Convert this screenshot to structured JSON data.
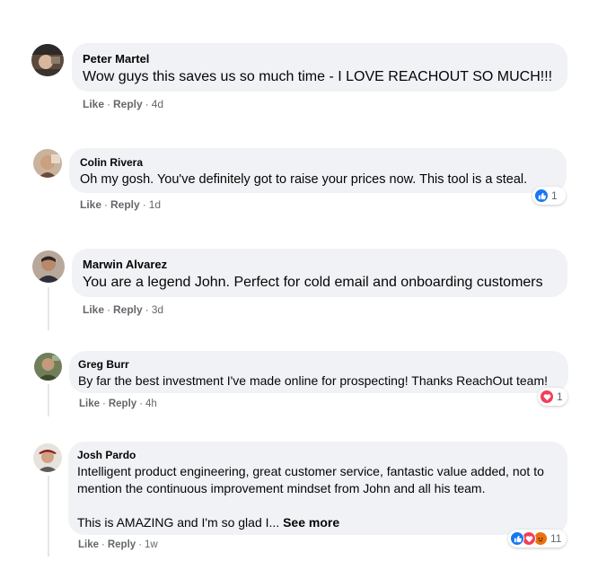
{
  "colors": {
    "bubble_bg": "#f0f2f5",
    "meta_text": "#65676b",
    "like_blue": "#1877f2",
    "love_red": "#f33e58",
    "angry_orange": "#e9710f"
  },
  "comments": [
    {
      "author": "Peter Martel",
      "text": "Wow guys this saves us so much time - I LOVE REACHOUT SO MUCH!!!",
      "like": "Like",
      "reply": "Reply",
      "time": "4d"
    },
    {
      "author": "Colin Rivera",
      "text": "Oh my gosh. You've definitely got to raise your prices now. This tool is a steal.",
      "like": "Like",
      "reply": "Reply",
      "time": "1d",
      "reactions": {
        "icons": [
          "like-icon"
        ],
        "count": "1"
      }
    },
    {
      "author": "Marwin Alvarez",
      "text": "You are a legend John. Perfect for cold email and onboarding customers",
      "like": "Like",
      "reply": "Reply",
      "time": "3d"
    },
    {
      "author": "Greg Burr",
      "text": "By far the best investment I've made online for prospecting! Thanks ReachOut team!",
      "like": "Like",
      "reply": "Reply",
      "time": "4h",
      "reactions": {
        "icons": [
          "love-icon"
        ],
        "count": "1"
      }
    },
    {
      "author": "Josh Pardo",
      "text_line1": "Intelligent product engineering, great customer service, fantastic value added, not to",
      "text_line2": "mention the continuous improvement mindset from John and all his team.",
      "text_line3": "This is AMAZING and I'm so glad I...",
      "see_more": "See more",
      "like": "Like",
      "reply": "Reply",
      "time": "1w",
      "reactions": {
        "icons": [
          "like-icon",
          "love-icon",
          "angry-icon"
        ],
        "count": "11"
      }
    }
  ]
}
